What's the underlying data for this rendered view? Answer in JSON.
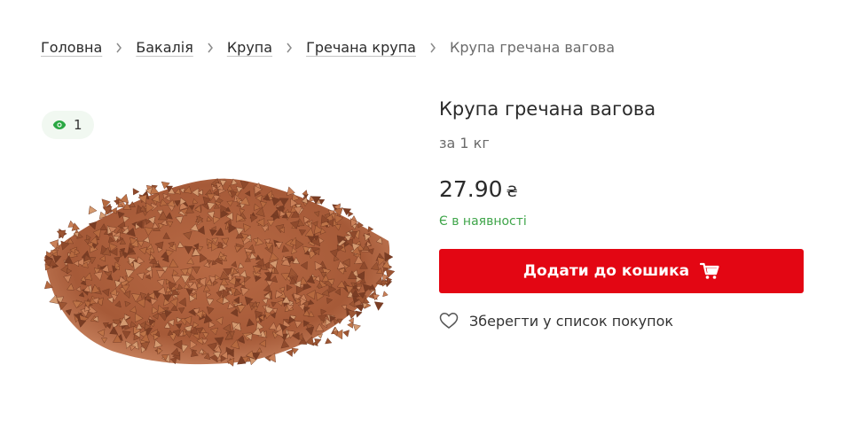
{
  "breadcrumb": [
    {
      "label": "Головна"
    },
    {
      "label": "Бакалія"
    },
    {
      "label": "Крупа"
    },
    {
      "label": "Гречана крупа"
    },
    {
      "label": "Крупа гречана вагова"
    }
  ],
  "views": {
    "count": "1",
    "icon": "eye-icon",
    "color": "#2aa843"
  },
  "product": {
    "title": "Крупа гречана вагова",
    "unit": "за 1 кг",
    "price": "27.90",
    "currency": "₴",
    "stock": "Є в наявності",
    "image": "buckwheat-groats"
  },
  "actions": {
    "add_to_cart": "Додати до кошика",
    "add_to_cart_icon": "cart-icon",
    "save_to_list": "Зберегти у список покупок",
    "save_icon": "heart-icon"
  },
  "colors": {
    "accent": "#e30613",
    "stock": "#3fa54a",
    "views_bg": "#f1f8f1"
  }
}
